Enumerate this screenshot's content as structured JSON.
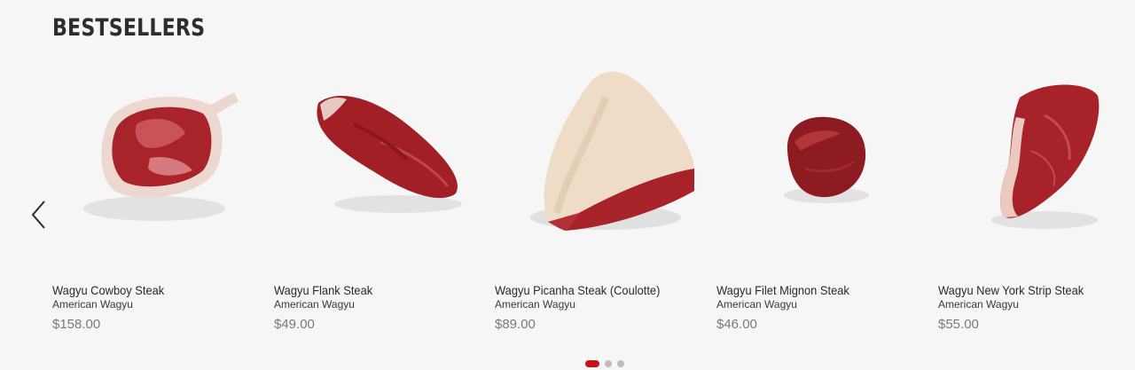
{
  "section": {
    "title": "BESTSELLERS"
  },
  "carousel": {
    "prev_icon": "chevron-left-icon",
    "products": [
      {
        "name": "Wagyu Cowboy Steak",
        "subtitle": "American Wagyu",
        "price": "$158.00",
        "image": "cowboy-steak"
      },
      {
        "name": "Wagyu Flank Steak",
        "subtitle": "American Wagyu",
        "price": "$49.00",
        "image": "flank-steak"
      },
      {
        "name": "Wagyu Picanha Steak (Coulotte)",
        "subtitle": "American Wagyu",
        "price": "$89.00",
        "image": "picanha-steak"
      },
      {
        "name": "Wagyu Filet Mignon Steak",
        "subtitle": "American Wagyu",
        "price": "$46.00",
        "image": "filet-mignon"
      },
      {
        "name": "Wagyu New York Strip Steak",
        "subtitle": "American Wagyu",
        "price": "$55.00",
        "image": "new-york-strip"
      }
    ],
    "pagination": {
      "pages": 3,
      "active": 1
    }
  },
  "colors": {
    "background": "#f6f6f6",
    "accent": "#c3161c",
    "price": "#7a7a7a",
    "meat": "#9e1c22",
    "fat": "#efd9cf"
  }
}
